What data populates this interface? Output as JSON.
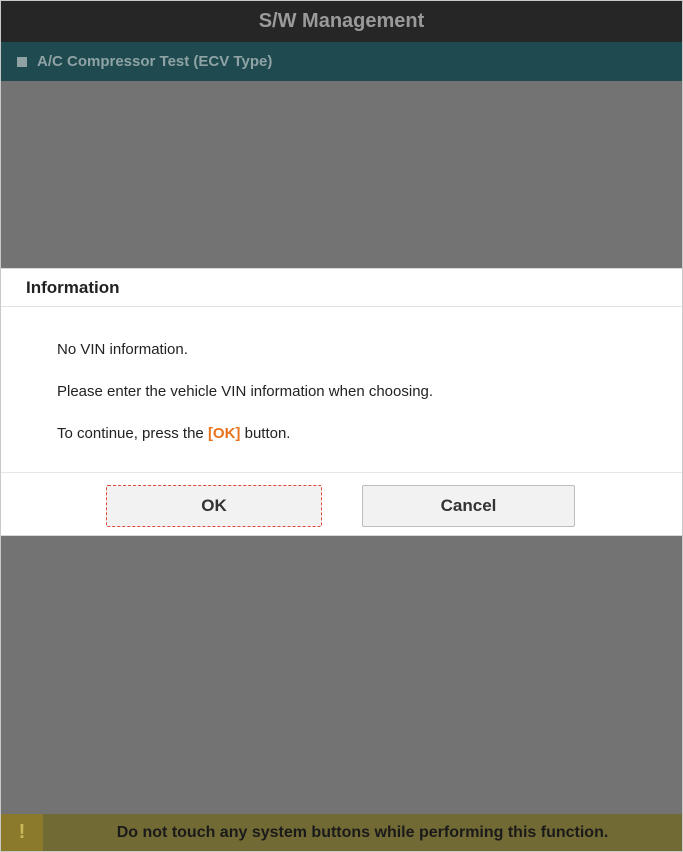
{
  "header": {
    "title": "S/W Management"
  },
  "subheader": {
    "icon": "square-bullet-icon",
    "title": "A/C Compressor Test (ECV Type)"
  },
  "dialog": {
    "title": "Information",
    "line1": "No VIN information.",
    "line2": "Please enter the vehicle VIN information when choosing.",
    "line3_before": "To continue, press the ",
    "line3_highlight": "[OK]",
    "line3_after": " button.",
    "ok_label": "OK",
    "cancel_label": "Cancel"
  },
  "footer": {
    "icon": "!",
    "icon_name": "warning-icon",
    "message": "Do not touch any system buttons while performing this function."
  },
  "colors": {
    "header_bg": "#262626",
    "subheader_bg": "#1f4a50",
    "overlay": "#737373",
    "highlight": "#e8731c",
    "warning_bg": "#726a34"
  }
}
